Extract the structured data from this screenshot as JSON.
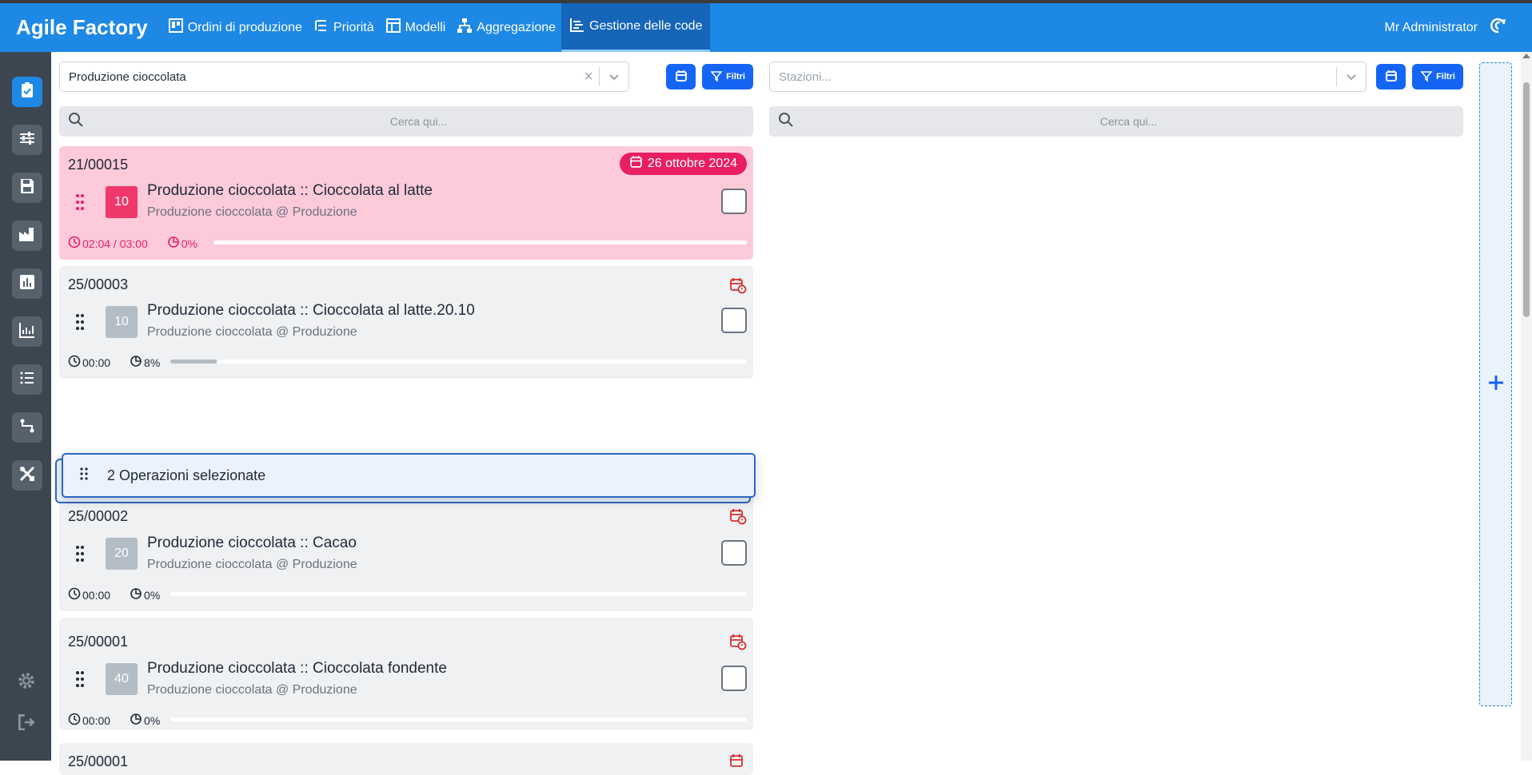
{
  "app": {
    "title": "Agile Factory"
  },
  "nav": {
    "items": [
      {
        "label": "Ordini di produzione",
        "icon": "orders-board-icon"
      },
      {
        "label": "Priorità",
        "icon": "priority-list-icon"
      },
      {
        "label": "Modelli",
        "icon": "template-icon"
      },
      {
        "label": "Aggregazione",
        "icon": "hierarchy-icon"
      },
      {
        "label": "Gestione delle code",
        "icon": "queue-icon",
        "active": true
      }
    ]
  },
  "user": {
    "name": "Mr Administrator"
  },
  "sidebar": {
    "items": [
      "clipboard-check-icon",
      "sliders-icon",
      "save-icon",
      "factory-icon",
      "bar-chart-icon",
      "line-chart-icon",
      "list-icon",
      "route-icon",
      "tools-icon"
    ],
    "bottom": [
      "settings-icon",
      "logout-icon"
    ]
  },
  "left_panel": {
    "select_value": "Produzione cioccolata",
    "filter_label": "Filtri",
    "search_placeholder": "Cerca qui..."
  },
  "right_panel": {
    "select_placeholder": "Stazioni...",
    "filter_label": "Filtri",
    "search_placeholder": "Cerca qui..."
  },
  "cards": [
    {
      "code": "21/00015",
      "date": "26 ottobre 2024",
      "priority": "10",
      "title": "Produzione cioccolata :: Cioccolata al latte",
      "subtitle": "Produzione cioccolata @ Produzione",
      "time": "02:04 / 03:00",
      "progress": "0%",
      "progress_value": 0
    },
    {
      "code": "25/00003",
      "priority": "10",
      "title": "Produzione cioccolata :: Cioccolata al latte.20.10",
      "subtitle": "Produzione cioccolata @ Produzione",
      "time": "00:00",
      "progress": "8%",
      "progress_value": 8
    },
    {
      "code": "25/00002",
      "priority": "20",
      "title": "Produzione cioccolata :: Cacao",
      "subtitle": "Produzione cioccolata @ Produzione",
      "time": "00:00",
      "progress": "0%",
      "progress_value": 0
    },
    {
      "code": "25/00001",
      "priority": "40",
      "title": "Produzione cioccolata :: Cioccolata fondente",
      "subtitle": "Produzione cioccolata @ Produzione",
      "time": "00:00",
      "progress": "0%",
      "progress_value": 0
    },
    {
      "code": "25/00001"
    }
  ],
  "drag": {
    "label": "2 Operazioni selezionate"
  },
  "colors": {
    "primary": "#1e88e5",
    "accent": "#e91e63",
    "button": "#1565f5",
    "sidebar": "#3b4651"
  }
}
